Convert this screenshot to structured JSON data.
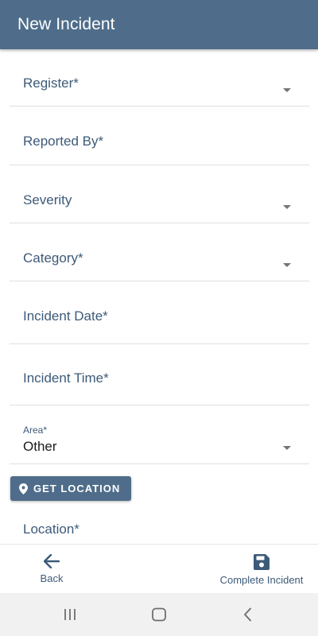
{
  "header": {
    "title": "New Incident"
  },
  "form": {
    "register": {
      "label": "Register*"
    },
    "reported_by": {
      "label": "Reported By*"
    },
    "severity": {
      "label": "Severity"
    },
    "category": {
      "label": "Category*"
    },
    "incident_date": {
      "label": "Incident Date*"
    },
    "incident_time": {
      "label": "Incident Time*"
    },
    "area": {
      "label": "Area*",
      "value": "Other"
    },
    "get_location_label": "GET LOCATION",
    "location": {
      "label": "Location*"
    }
  },
  "bottom_bar": {
    "back_label": "Back",
    "complete_label": "Complete Incident"
  },
  "icons": {
    "back": "arrow-left-icon",
    "complete": "save-icon",
    "location": "map-pin-icon",
    "dropdown": "caret-down-icon"
  },
  "colors": {
    "primary": "#4f6d8a",
    "label_text": "#3d5a78",
    "divider": "#dcdfe3",
    "nav_background": "#f1f1f1"
  }
}
